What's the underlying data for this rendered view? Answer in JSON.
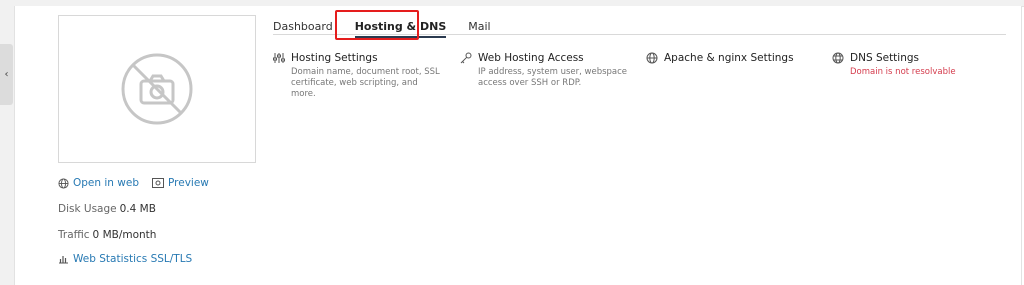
{
  "thumbnail": {
    "icon": "no-camera-icon"
  },
  "links": {
    "open_in_web": "Open in web",
    "preview": "Preview"
  },
  "stats": {
    "disk_usage_label": "Disk Usage",
    "disk_usage_value": "0.4 MB",
    "traffic_label": "Traffic",
    "traffic_value": "0 MB/month",
    "web_statistics": "Web Statistics SSL/TLS"
  },
  "tabs": [
    {
      "label": "Dashboard",
      "active": false
    },
    {
      "label": "Hosting & DNS",
      "active": true
    },
    {
      "label": "Mail",
      "active": false
    }
  ],
  "tools": [
    {
      "title": "Hosting Settings",
      "icon": "sliders-icon",
      "description": "Domain name, document root, SSL certificate, web scripting, and more."
    },
    {
      "title": "Web Hosting Access",
      "icon": "key-icon",
      "description": "IP address, system user, webspace access over SSH or RDP."
    },
    {
      "title": "Apache & nginx Settings",
      "icon": "globe-gear-icon",
      "description": ""
    },
    {
      "title": "DNS Settings",
      "icon": "globe-icon",
      "warning": "Domain is not resolvable"
    }
  ],
  "colors": {
    "link": "#2779b3",
    "warning": "#d43c4d",
    "highlight": "#e51d1d"
  }
}
